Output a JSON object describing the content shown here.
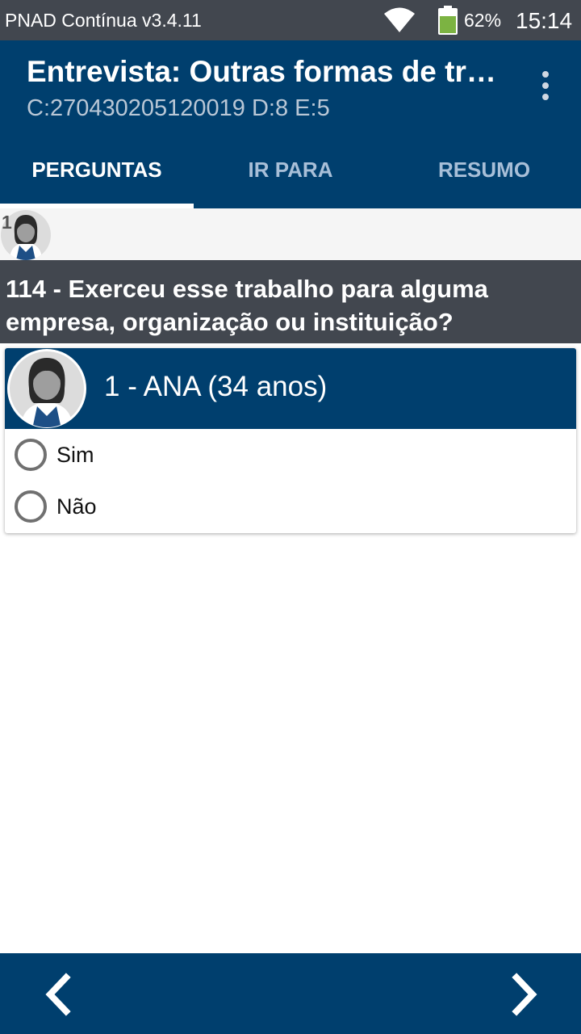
{
  "status_bar": {
    "app_label": "PNAD Contínua v3.4.11",
    "battery_percent": "62%",
    "time": "15:14",
    "icons": [
      "wifi-icon",
      "battery-icon"
    ]
  },
  "app_bar": {
    "title": "Entrevista: Outras formas de trabalho",
    "subtitle": "C:270430205120019 D:8 E:5"
  },
  "tabs": [
    {
      "label": "PERGUNTAS",
      "active": true
    },
    {
      "label": "IR PARA",
      "active": false
    },
    {
      "label": "RESUMO",
      "active": false
    }
  ],
  "respondent_strip": {
    "number": "1"
  },
  "question": {
    "text": "114 - Exerceu esse trabalho para alguma empresa, organização ou instituição?"
  },
  "card": {
    "person": "1 - ANA (34 anos)",
    "options": [
      {
        "label": "Sim",
        "selected": false
      },
      {
        "label": "Não",
        "selected": false
      }
    ]
  },
  "colors": {
    "primary": "#003f6e",
    "header_gray": "#42474f",
    "tab_inactive": "#a8bfd8"
  }
}
